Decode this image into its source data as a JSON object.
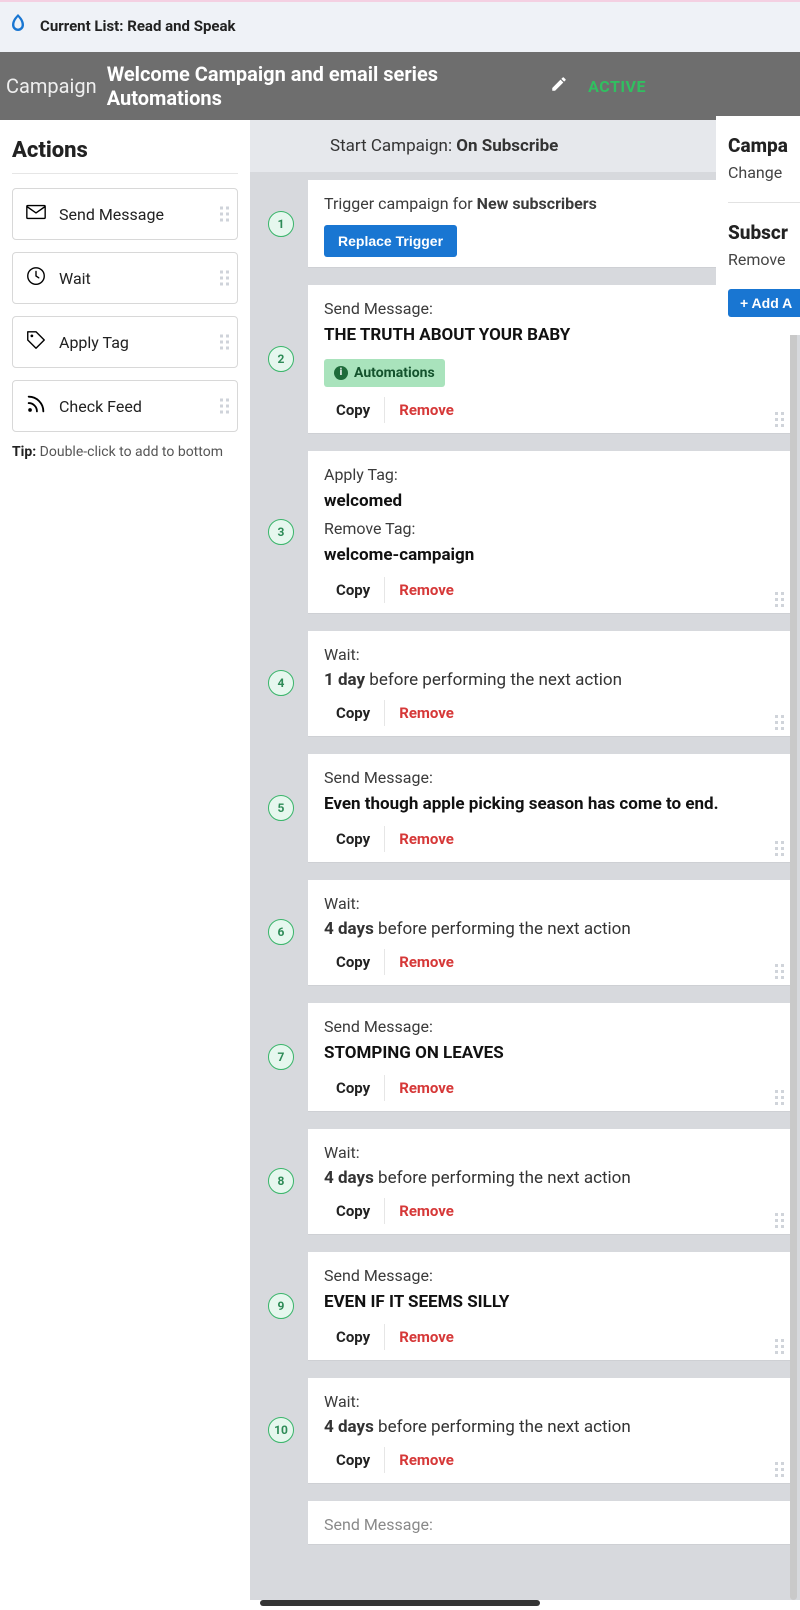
{
  "listbar": {
    "current_prefix": "Current List: ",
    "list_name": "Read and Speak"
  },
  "campbar": {
    "label": "Campaign",
    "title": "Welcome Campaign and email series Automations",
    "status": "ACTIVE"
  },
  "sidebar": {
    "heading": "Actions",
    "items": [
      {
        "icon": "envelope",
        "label": "Send Message"
      },
      {
        "icon": "clock",
        "label": "Wait"
      },
      {
        "icon": "tag",
        "label": "Apply Tag"
      },
      {
        "icon": "feed",
        "label": "Check Feed"
      }
    ],
    "tip_label": "Tip:",
    "tip_text": " Double-click to add to bottom"
  },
  "canvas": {
    "start_label": "Start Campaign: ",
    "start_value": "On Subscribe",
    "steps": [
      {
        "num": "1",
        "type": "trigger",
        "heading": "Trigger campaign for ",
        "bold": "New subscribers",
        "button": "Replace Trigger"
      },
      {
        "num": "2",
        "type": "message_badge",
        "heading": "Send Message:",
        "title": "THE TRUTH ABOUT YOUR BABY",
        "badge": "Automations",
        "copy": "Copy",
        "remove": "Remove"
      },
      {
        "num": "3",
        "type": "tag",
        "apply_label": "Apply Tag:",
        "apply_value": "welcomed",
        "remove_label": "Remove Tag:",
        "remove_value": "welcome-campaign",
        "copy": "Copy",
        "remove": "Remove"
      },
      {
        "num": "4",
        "type": "wait",
        "heading": "Wait:",
        "bold": "1 day",
        "rest": " before performing the next action",
        "copy": "Copy",
        "remove": "Remove"
      },
      {
        "num": "5",
        "type": "message",
        "heading": "Send Message:",
        "title": "Even though apple picking season has come to end.",
        "copy": "Copy",
        "remove": "Remove"
      },
      {
        "num": "6",
        "type": "wait",
        "heading": "Wait:",
        "bold": "4 days",
        "rest": " before performing the next action",
        "copy": "Copy",
        "remove": "Remove"
      },
      {
        "num": "7",
        "type": "message",
        "heading": "Send Message:",
        "title": "STOMPING ON LEAVES",
        "copy": "Copy",
        "remove": "Remove"
      },
      {
        "num": "8",
        "type": "wait",
        "heading": "Wait:",
        "bold": "4 days",
        "rest": " before performing the next action",
        "copy": "Copy",
        "remove": "Remove"
      },
      {
        "num": "9",
        "type": "message",
        "heading": "Send Message:",
        "title": "EVEN IF IT SEEMS SILLY",
        "copy": "Copy",
        "remove": "Remove"
      },
      {
        "num": "10",
        "type": "wait",
        "heading": "Wait:",
        "bold": "4 days",
        "rest": " before performing the next action",
        "copy": "Copy",
        "remove": "Remove"
      },
      {
        "num": "",
        "type": "message_cut",
        "heading": "Send Message:"
      }
    ]
  },
  "rightpanel": {
    "heading1": "Campa",
    "line1": "Change ",
    "heading2": "Subscr",
    "line2": "Remove",
    "addbtn": "+ Add A"
  }
}
